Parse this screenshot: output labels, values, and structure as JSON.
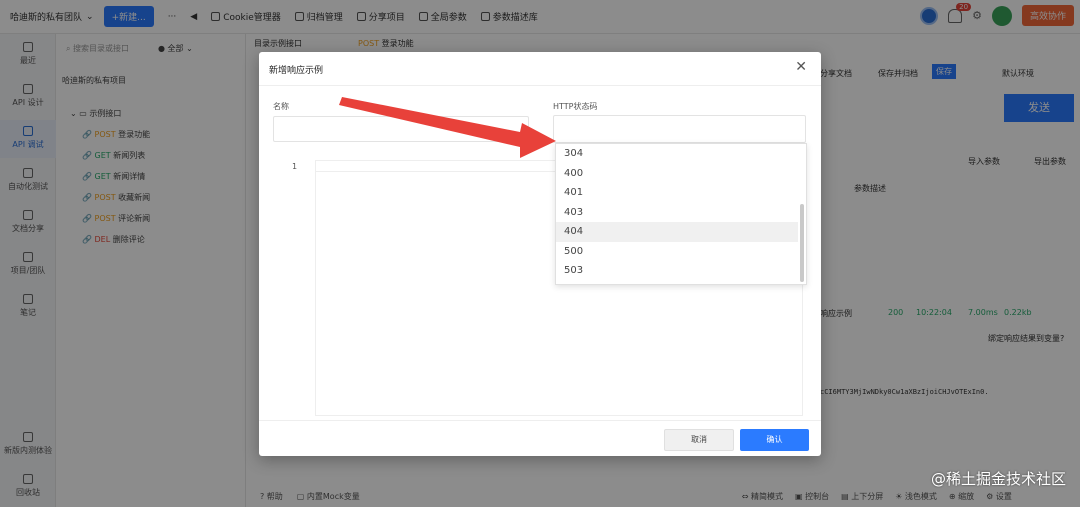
{
  "topbar": {
    "team": "哈迪斯的私有团队",
    "new_button": "+新建...",
    "items": [
      "Cookie管理器",
      "归档管理",
      "分享项目",
      "全局参数",
      "参数描述库"
    ],
    "notif_count": "20",
    "collab": "高效协作"
  },
  "leftnav": {
    "items": [
      "最近",
      "API 设计",
      "API 调试",
      "自动化测试",
      "文档分享",
      "项目/团队",
      "笔记",
      "新版内测体验",
      "回收站"
    ]
  },
  "tree": {
    "search_placeholder": "搜索目录或接口",
    "filter": "全部",
    "project": "哈迪斯的私有项目",
    "folder": "示例接口",
    "apis": [
      {
        "method": "POST",
        "name": "登录功能"
      },
      {
        "method": "GET",
        "name": "新闻列表"
      },
      {
        "method": "GET",
        "name": "新闻详情"
      },
      {
        "method": "POST",
        "name": "收藏新闻"
      },
      {
        "method": "POST",
        "name": "评论新闻"
      },
      {
        "method": "DEL",
        "name": "删除评论"
      }
    ]
  },
  "tabs": {
    "tab1": "目录示例接口",
    "tab2_method": "POST",
    "tab2_name": "登录功能"
  },
  "main": {
    "share_doc": "分享文档",
    "save_archive": "保存并归档",
    "save": "保存",
    "env": "默认环境",
    "send": "发送",
    "import_params": "导入参数",
    "export_params": "导出参数",
    "param_desc": "参数描述",
    "resp_example": "响应示例",
    "status": "200",
    "time": "10:22:04",
    "duration": "7.00ms",
    "size": "0.22kb",
    "bind_result": "绑定响应结果到变量?",
    "token_snippet": "cCI6MTY3MjIwNDky0Cw1aXBzIjoiCHJvOTExIn0."
  },
  "modal": {
    "title": "新增响应示例",
    "name_label": "名称",
    "status_label": "HTTP状态码",
    "line_no": "1",
    "cancel": "取消",
    "confirm": "确认",
    "status_options": [
      "304",
      "400",
      "401",
      "403",
      "404",
      "500",
      "503"
    ],
    "hovered": "404"
  },
  "bottombar": {
    "help": "帮助",
    "mock": "内置Mock变量",
    "mode": "精简模式",
    "console": "控制台",
    "split": "上下分屏",
    "theme": "浅色模式",
    "zoom": "缩放",
    "settings": "设置"
  },
  "watermark": "@稀土掘金技术社区"
}
